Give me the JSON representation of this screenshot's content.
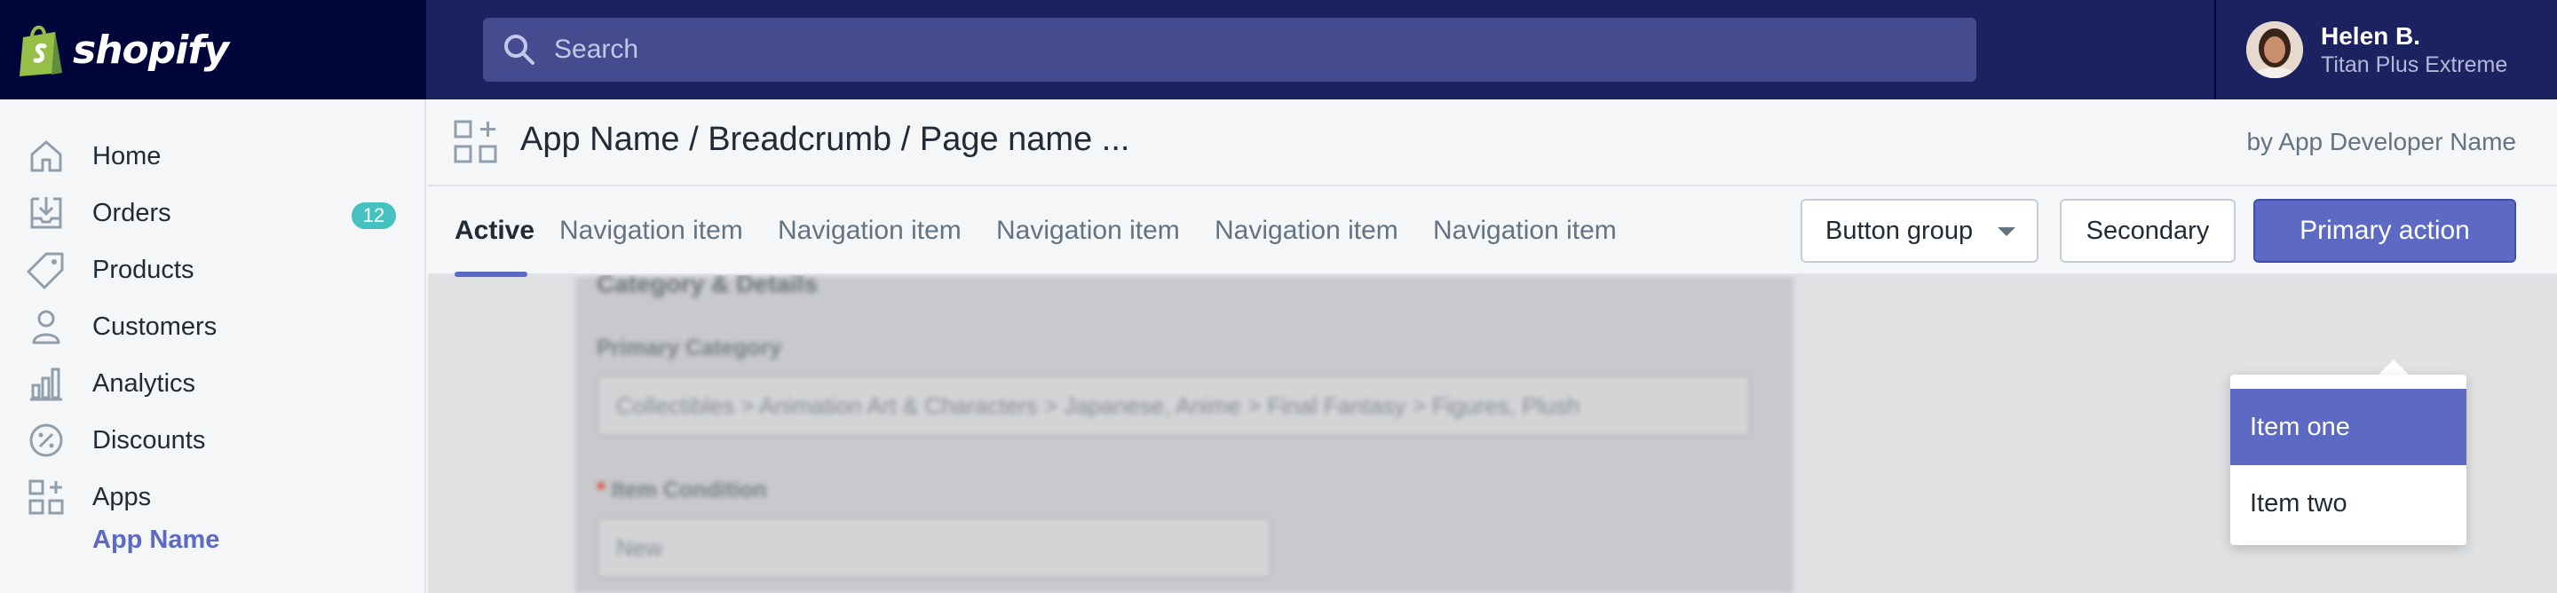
{
  "topbar": {
    "brand": "shopify",
    "search_placeholder": "Search",
    "user": {
      "name": "Helen B.",
      "store": "Titan Plus Extreme"
    }
  },
  "sidebar": {
    "items": [
      {
        "label": "Home",
        "icon": "home-icon"
      },
      {
        "label": "Orders",
        "icon": "orders-icon",
        "badge": "12"
      },
      {
        "label": "Products",
        "icon": "tag-icon"
      },
      {
        "label": "Customers",
        "icon": "person-icon"
      },
      {
        "label": "Analytics",
        "icon": "bar-chart-icon"
      },
      {
        "label": "Discounts",
        "icon": "discount-icon"
      },
      {
        "label": "Apps",
        "icon": "apps-icon"
      }
    ],
    "sub_item": "App Name"
  },
  "header": {
    "title": "App Name / Breadcrumb / Page name ...",
    "developer": "by App Developer Name"
  },
  "tabs": [
    {
      "label": "Active",
      "active": true
    },
    {
      "label": "Navigation item"
    },
    {
      "label": "Navigation item"
    },
    {
      "label": "Navigation item"
    },
    {
      "label": "Navigation item"
    },
    {
      "label": "Navigation item"
    }
  ],
  "actions": {
    "button_group": "Button group",
    "secondary": "Secondary",
    "primary": "Primary action"
  },
  "dropdown": {
    "items": [
      {
        "label": "Item one",
        "selected": true
      },
      {
        "label": "Item two",
        "selected": false
      }
    ]
  },
  "content": {
    "section_heading": "Category & Details",
    "primary_category_label": "Primary Category",
    "primary_category_value": "Collectibles > Animation Art & Characters > Japanese, Anime > Final Fantasy > Figures, Plush",
    "item_condition_label": "Item Condition",
    "item_condition_value": "New"
  },
  "colors": {
    "topbar": "#1c2260",
    "brand_bg": "#000639",
    "accent": "#5c6ac4",
    "badge": "#47c1bf"
  }
}
